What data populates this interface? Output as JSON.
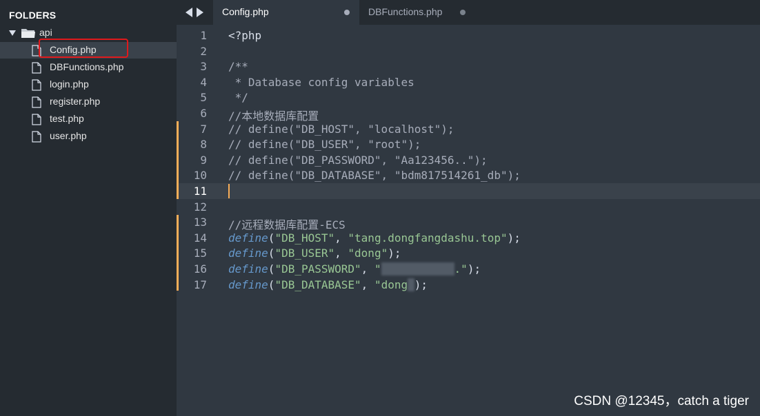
{
  "sidebar": {
    "title": "FOLDERS",
    "folder": "api",
    "files": [
      "Config.php",
      "DBFunctions.php",
      "login.php",
      "register.php",
      "test.php",
      "user.php"
    ]
  },
  "tabs": [
    {
      "label": "Config.php",
      "active": true
    },
    {
      "label": "DBFunctions.php",
      "active": false
    }
  ],
  "editor": {
    "current_line": 11,
    "lines": [
      {
        "n": "1",
        "parts": [
          [
            "pun",
            "<?php"
          ]
        ]
      },
      {
        "n": "2",
        "parts": []
      },
      {
        "n": "3",
        "parts": [
          [
            "cmt",
            "/**"
          ]
        ]
      },
      {
        "n": "4",
        "parts": [
          [
            "cmt",
            " * Database config variables"
          ]
        ]
      },
      {
        "n": "5",
        "parts": [
          [
            "cmt",
            " */"
          ]
        ]
      },
      {
        "n": "6",
        "parts": [
          [
            "cmt",
            "//本地数据库配置"
          ]
        ]
      },
      {
        "n": "7",
        "parts": [
          [
            "cmt",
            "// define(\"DB_HOST\", \"localhost\");"
          ]
        ]
      },
      {
        "n": "8",
        "parts": [
          [
            "cmt",
            "// define(\"DB_USER\", \"root\");"
          ]
        ]
      },
      {
        "n": "9",
        "parts": [
          [
            "cmt",
            "// define(\"DB_PASSWORD\", \"Aa123456..\");"
          ]
        ]
      },
      {
        "n": "10",
        "parts": [
          [
            "cmt",
            "// define(\"DB_DATABASE\", \"bdm817514261_db\");"
          ]
        ]
      },
      {
        "n": "11",
        "parts": []
      },
      {
        "n": "12",
        "parts": []
      },
      {
        "n": "13",
        "parts": [
          [
            "cmt",
            "//远程数据库配置-ECS"
          ]
        ]
      },
      {
        "n": "14",
        "parts": [
          [
            "fn",
            "define"
          ],
          [
            "pun",
            "("
          ],
          [
            "str",
            "\"DB_HOST\""
          ],
          [
            "pun",
            ", "
          ],
          [
            "str",
            "\"tang.dongfangdashu.top\""
          ],
          [
            "pun",
            ");"
          ]
        ]
      },
      {
        "n": "15",
        "parts": [
          [
            "fn",
            "define"
          ],
          [
            "pun",
            "("
          ],
          [
            "str",
            "\"DB_USER\""
          ],
          [
            "pun",
            ", "
          ],
          [
            "str",
            "\"dong\""
          ],
          [
            "pun",
            ");"
          ]
        ]
      },
      {
        "n": "16",
        "parts": [
          [
            "fn",
            "define"
          ],
          [
            "pun",
            "("
          ],
          [
            "str",
            "\"DB_PASSWORD\""
          ],
          [
            "pun",
            ", "
          ],
          [
            "str",
            "\""
          ],
          [
            "blur",
            "xxxxxxxxxxx"
          ],
          [
            "str",
            ".\""
          ],
          [
            "pun",
            ");"
          ]
        ]
      },
      {
        "n": "17",
        "parts": [
          [
            "fn",
            "define"
          ],
          [
            "pun",
            "("
          ],
          [
            "str",
            "\"DB_DATABASE\""
          ],
          [
            "pun",
            ", "
          ],
          [
            "str",
            "\"dong"
          ],
          [
            "blur",
            "x"
          ],
          [
            "pun",
            ");"
          ]
        ]
      }
    ]
  },
  "watermark": "CSDN @12345，catch a tiger",
  "colors": {
    "background": "#303841",
    "sidebar": "#252b31",
    "comment": "#a7adba",
    "string": "#99c794",
    "function": "#6699cc",
    "modified_marker": "#f9ae58",
    "highlight_box": "#e0191b"
  }
}
